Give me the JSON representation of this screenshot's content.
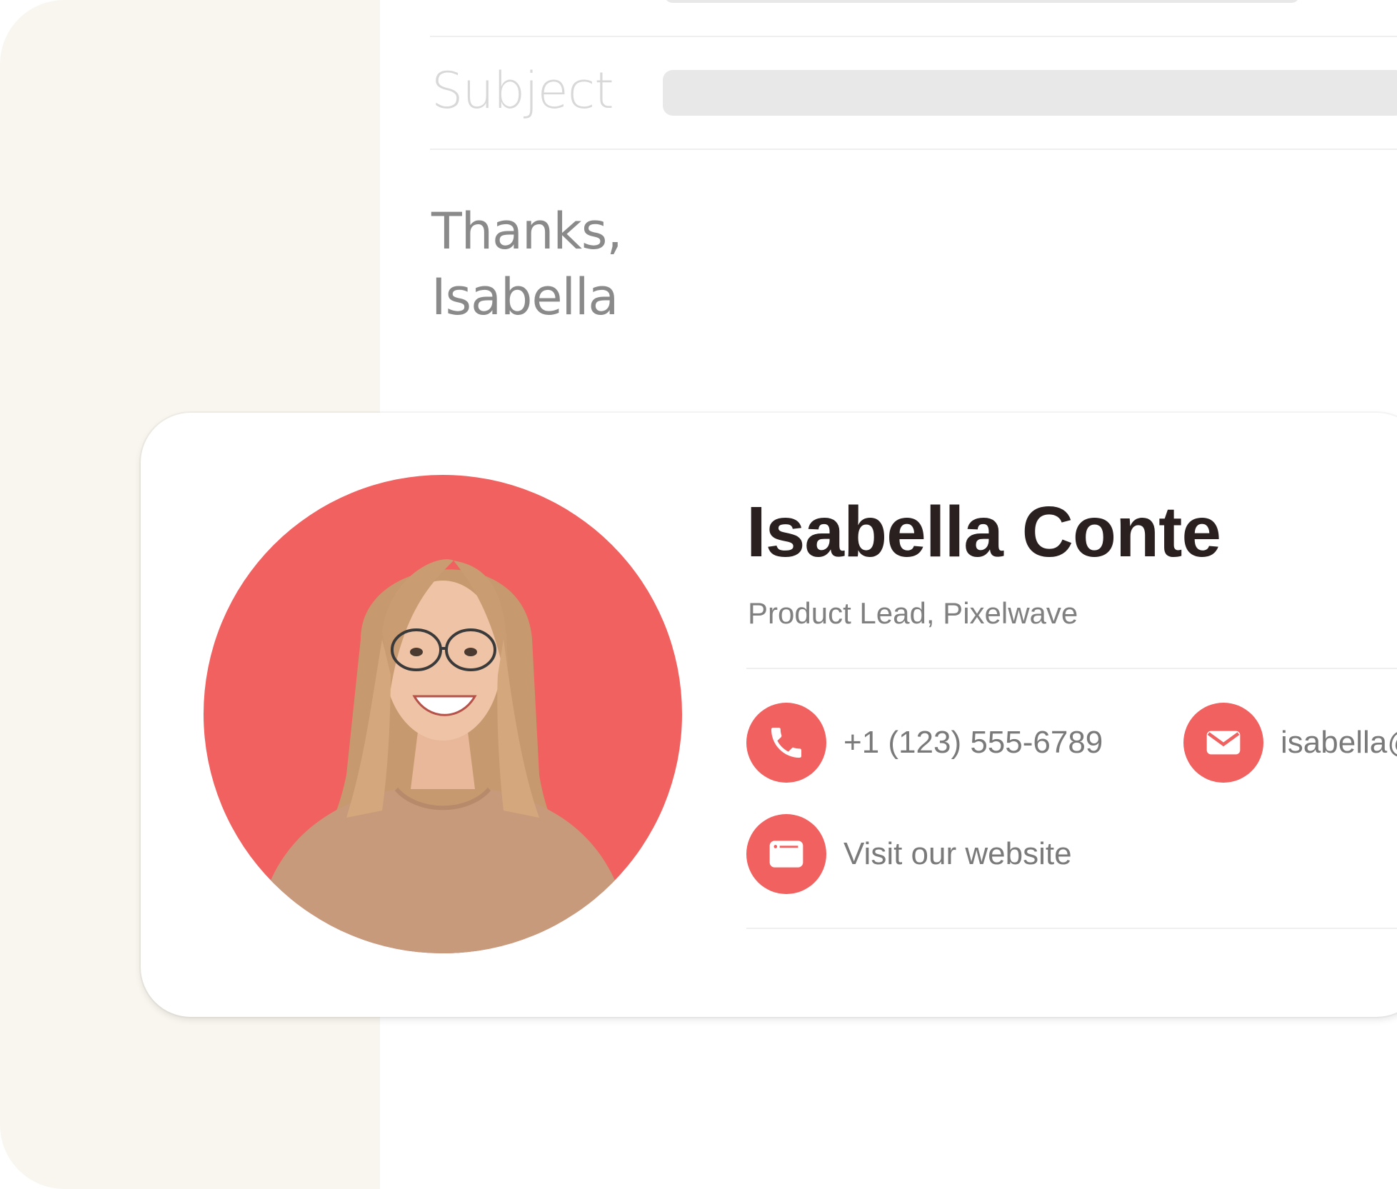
{
  "email": {
    "subject_label": "Subject",
    "subject_value": "",
    "body_lines": [
      "Thanks,",
      "Isabella"
    ]
  },
  "signature": {
    "name": "Isabella Conte",
    "title": "Product Lead, Pixelwave",
    "avatar_background": "#f06160",
    "contacts": {
      "phone": {
        "icon": "phone-icon",
        "text": "+1 (123) 555-6789"
      },
      "email": {
        "icon": "envelope-icon",
        "text": "isabella@"
      },
      "website": {
        "icon": "browser-window-icon",
        "text": "Visit our website"
      }
    }
  },
  "colors": {
    "accent": "#f06160",
    "name_text": "#2b2020",
    "panel_bg": "#f9f6ef"
  }
}
